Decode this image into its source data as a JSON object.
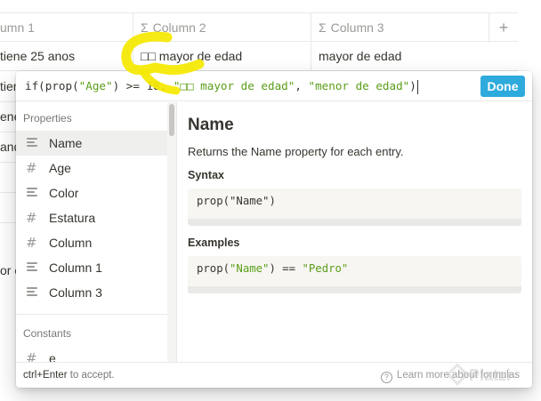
{
  "table": {
    "headers": [
      "umn 1",
      "Column 2",
      "Column 3"
    ],
    "add_label": "+",
    "sigma_glyph": "Σ",
    "row1": {
      "c1": "tiene 25 anos",
      "c2": "□□ mayor de edad",
      "c3": "mayor de edad"
    },
    "left_fragments": [
      "tien",
      "ene",
      "and",
      "or c"
    ]
  },
  "formula": {
    "prefix": "if(prop(",
    "s1": "\"Age\"",
    "mid": ") >= 18, ",
    "s2": "\"□□ mayor de edad\"",
    "comma": ", ",
    "s3": "\"menor de edad\"",
    "suffix": ")",
    "done_label": "Done"
  },
  "sidebar": {
    "properties_heading": "Properties",
    "properties": [
      {
        "label": "Name",
        "icon": "text-lines-icon",
        "selected": true
      },
      {
        "label": "Age",
        "icon": "number-hash-icon"
      },
      {
        "label": "Color",
        "icon": "text-lines-icon"
      },
      {
        "label": "Estatura",
        "icon": "number-hash-icon"
      },
      {
        "label": "Column",
        "icon": "number-hash-icon"
      },
      {
        "label": "Column 1",
        "icon": "text-lines-icon"
      },
      {
        "label": "Column 3",
        "icon": "text-lines-icon"
      }
    ],
    "constants_heading": "Constants",
    "constants": [
      {
        "label": "e",
        "icon": "number-hash-icon"
      }
    ]
  },
  "doc": {
    "title": "Name",
    "description": "Returns the Name property for each entry.",
    "syntax_heading": "Syntax",
    "syntax_prefix": "prop(",
    "syntax_str": "\"Name\"",
    "syntax_suffix": ")",
    "examples_heading": "Examples",
    "ex_prefix": "prop(",
    "ex_str": "\"Name\"",
    "ex_mid": ") == ",
    "ex_str2": "\"Pedro\""
  },
  "footer": {
    "hint_key": "ctrl+Enter",
    "hint_rest": " to accept.",
    "learn": "Learn more about formulas"
  },
  "watermark": "Platzi",
  "colors": {
    "accent": "#2eaadc",
    "string": "#5a9e17",
    "highlight": "#f5e800"
  }
}
